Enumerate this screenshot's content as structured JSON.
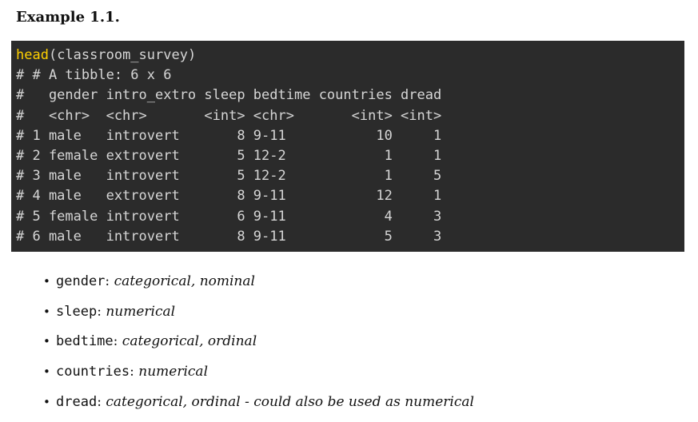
{
  "heading": "Example 1.1.",
  "code": {
    "call_function": "head",
    "call_args": "(classroom_survey)",
    "output_lines": [
      "# # A tibble: 6 x 6",
      "#   gender intro_extro sleep bedtime countries dread",
      "#   <chr>  <chr>       <int> <chr>       <int> <int>",
      "# 1 male   introvert       8 9-11           10     1",
      "# 2 female extrovert       5 12-2            1     1",
      "# 3 male   introvert       5 12-2            1     5",
      "# 4 male   extrovert       8 9-11           12     1",
      "# 5 female introvert       6 9-11            4     3",
      "# 6 male   introvert       8 9-11            5     3"
    ]
  },
  "bullets": [
    {
      "term": "gender",
      "separator": ": ",
      "description": "categorical, nominal"
    },
    {
      "term": "sleep",
      "separator": ": ",
      "description": "numerical"
    },
    {
      "term": "bedtime",
      "separator": ": ",
      "description": "categorical, ordinal"
    },
    {
      "term": "countries",
      "separator": ": ",
      "description": "numerical"
    },
    {
      "term": "dread",
      "separator": ": ",
      "description": "categorical, ordinal - could also be used as numerical"
    }
  ],
  "bullet_symbol": "•"
}
